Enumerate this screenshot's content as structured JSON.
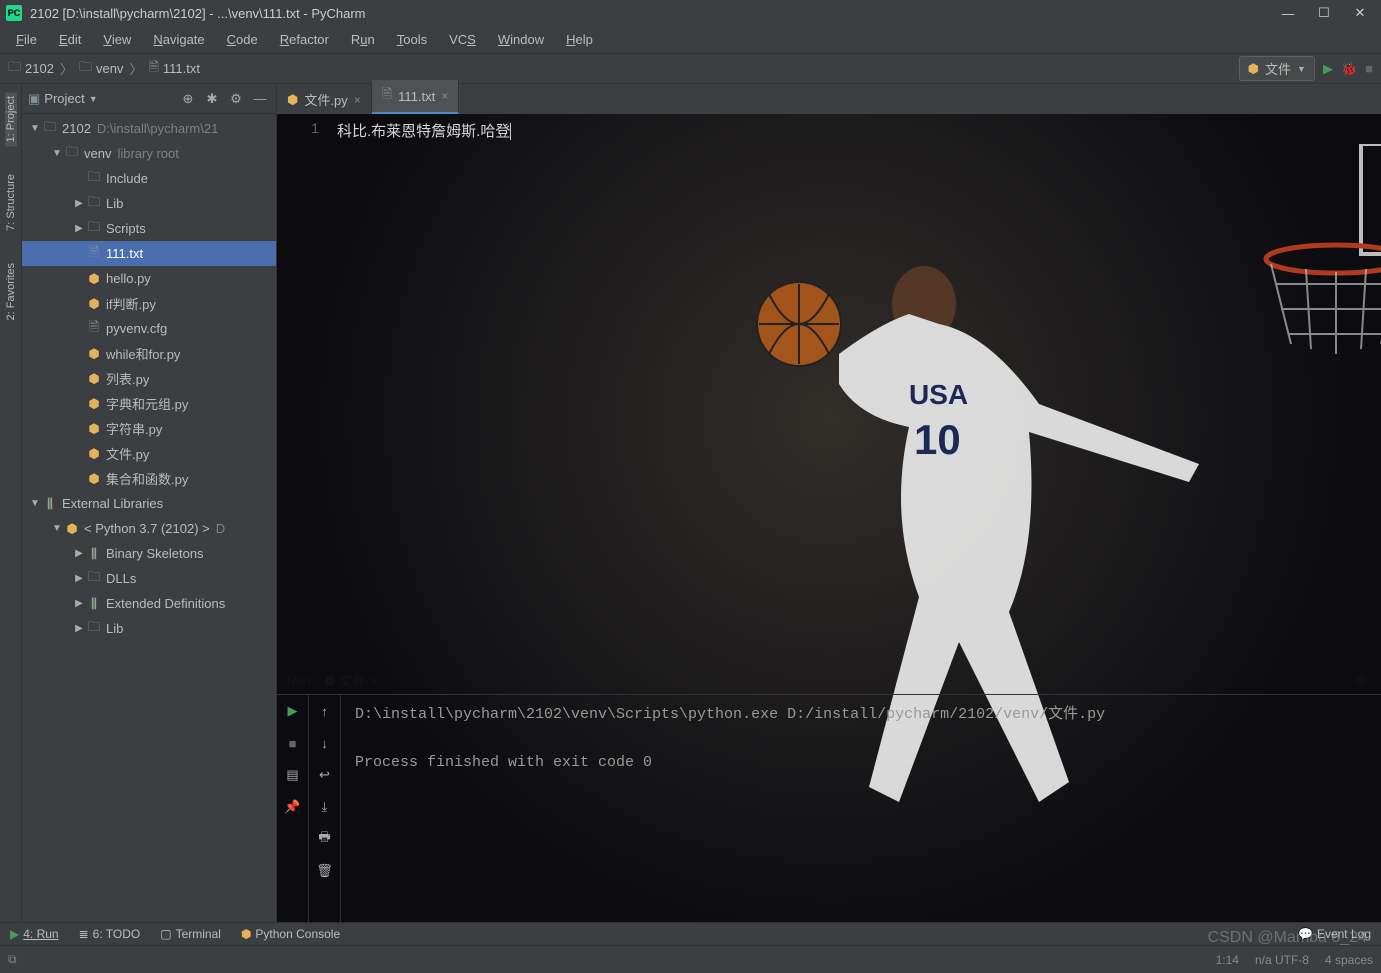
{
  "window": {
    "title": "2102 [D:\\install\\pycharm\\2102] - ...\\venv\\111.txt - PyCharm"
  },
  "menubar": [
    {
      "label": "File",
      "m": "F"
    },
    {
      "label": "Edit",
      "m": "E"
    },
    {
      "label": "View",
      "m": "V"
    },
    {
      "label": "Navigate",
      "m": "N"
    },
    {
      "label": "Code",
      "m": "C"
    },
    {
      "label": "Refactor",
      "m": "R"
    },
    {
      "label": "Run",
      "m": "u"
    },
    {
      "label": "Tools",
      "m": "T"
    },
    {
      "label": "VCS",
      "m": "S"
    },
    {
      "label": "Window",
      "m": "W"
    },
    {
      "label": "Help",
      "m": "H"
    }
  ],
  "breadcrumbs": [
    {
      "icon": "folder",
      "label": "2102"
    },
    {
      "icon": "folder",
      "label": "venv"
    },
    {
      "icon": "file",
      "label": "111.txt"
    }
  ],
  "run_config": {
    "label": "文件"
  },
  "side_tabs_left": [
    {
      "name": "project",
      "label": "1: Project",
      "active": true
    },
    {
      "name": "structure",
      "label": "7: Structure",
      "active": false
    },
    {
      "name": "favorites",
      "label": "2: Favorites",
      "active": false
    }
  ],
  "project_panel": {
    "title": "Project",
    "tree": [
      {
        "d": 0,
        "exp": "open",
        "ico": "folder",
        "label": "2102",
        "ext": "D:\\install\\pycharm\\21"
      },
      {
        "d": 1,
        "exp": "open",
        "ico": "folder",
        "label": "venv",
        "ext": "library root"
      },
      {
        "d": 2,
        "exp": "none",
        "ico": "folder",
        "label": "Include"
      },
      {
        "d": 2,
        "exp": "closed",
        "ico": "folder",
        "label": "Lib"
      },
      {
        "d": 2,
        "exp": "closed",
        "ico": "folder",
        "label": "Scripts"
      },
      {
        "d": 2,
        "exp": "none",
        "ico": "txt",
        "label": "111.txt",
        "sel": true
      },
      {
        "d": 2,
        "exp": "none",
        "ico": "py",
        "label": "hello.py"
      },
      {
        "d": 2,
        "exp": "none",
        "ico": "py",
        "label": "if判断.py"
      },
      {
        "d": 2,
        "exp": "none",
        "ico": "txt",
        "label": "pyvenv.cfg"
      },
      {
        "d": 2,
        "exp": "none",
        "ico": "py",
        "label": "while和for.py"
      },
      {
        "d": 2,
        "exp": "none",
        "ico": "py",
        "label": "列表.py"
      },
      {
        "d": 2,
        "exp": "none",
        "ico": "py",
        "label": "字典和元组.py"
      },
      {
        "d": 2,
        "exp": "none",
        "ico": "py",
        "label": "字符串.py"
      },
      {
        "d": 2,
        "exp": "none",
        "ico": "py",
        "label": "文件.py"
      },
      {
        "d": 2,
        "exp": "none",
        "ico": "py",
        "label": "集合和函数.py"
      },
      {
        "d": 0,
        "exp": "open",
        "ico": "lib",
        "label": "External Libraries"
      },
      {
        "d": 1,
        "exp": "open",
        "ico": "py",
        "label": "< Python 3.7 (2102) >",
        "ext": "D"
      },
      {
        "d": 2,
        "exp": "closed",
        "ico": "lib",
        "label": "Binary Skeletons"
      },
      {
        "d": 2,
        "exp": "closed",
        "ico": "folder",
        "label": "DLLs"
      },
      {
        "d": 2,
        "exp": "closed",
        "ico": "lib",
        "label": "Extended Definitions"
      },
      {
        "d": 2,
        "exp": "closed",
        "ico": "folder",
        "label": "Lib"
      }
    ]
  },
  "tabs": [
    {
      "icon": "py",
      "label": "文件.py",
      "active": false
    },
    {
      "icon": "txt",
      "label": "111.txt",
      "active": true
    }
  ],
  "editor": {
    "line_no": "1",
    "content": "科比.布莱恩特詹姆斯.哈登"
  },
  "run_panel": {
    "label": "Run:",
    "name": "文件",
    "output": "D:\\install\\pycharm\\2102\\venv\\Scripts\\python.exe D:/install/pycharm/2102/venv/文件.py\n\nProcess finished with exit code 0"
  },
  "bottom_strip": {
    "run": "4: Run",
    "todo": "6: TODO",
    "terminal": "Terminal",
    "pyconsole": "Python Console",
    "eventlog": "Event Log"
  },
  "statusbar": {
    "pos": "1:14",
    "enc": "n/a   UTF-8",
    "indent": "4 spaces"
  },
  "watermark": "CSDN @Mamba 8_24"
}
